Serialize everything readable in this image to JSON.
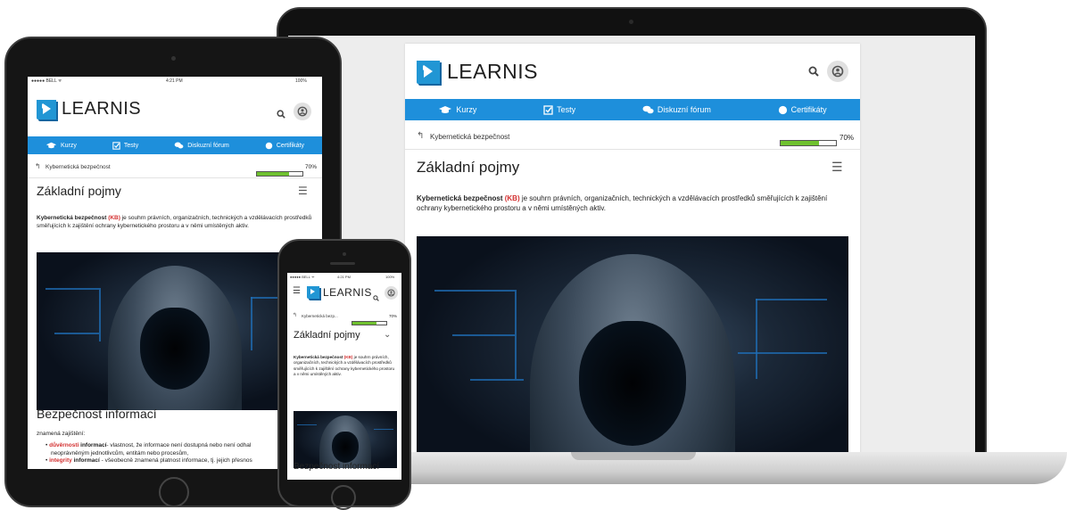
{
  "brand": {
    "name": "LEARNIS"
  },
  "nav": {
    "courses": "Kurzy",
    "tests": "Testy",
    "forum": "Diskuzní fórum",
    "certificates": "Certifikáty"
  },
  "breadcrumb": {
    "label": "Kybernetická bezpečnost",
    "short_label": "Kybernetická bezp...",
    "progress_text": "70%",
    "progress_value": 0.7
  },
  "lesson": {
    "title": "Základní pojmy",
    "intro_bold": "Kybernetická bezpečnost",
    "intro_abbr": "(KB)",
    "intro_rest": "je souhrn právních, organizačních, technických a vzdělávacích prostředků směřujících k zajištění ochrany kybernetického prostoru a v němi umístěných aktiv.",
    "section_title": "Bezpečnost informací",
    "section_intro": "znamená zajištění:",
    "bullets": [
      {
        "term": "důvěrnosti",
        "bold": "informací",
        "rest": "- vlastnost, že informace není dostupná nebo není odhal"
      },
      {
        "cont": "neoprávněným jednotlivcům, entitám nebo procesům,"
      },
      {
        "term": "integrity",
        "bold": "informací",
        "rest": "- všeobecně znamená platnost informace, tj. jejich přesnos"
      }
    ]
  },
  "tablet_status": {
    "carrier": "●●●●● BELL ᯤ",
    "time": "4:21 PM",
    "battery": "100%"
  },
  "phone_status": {
    "carrier": "●●●●● BELL ᯤ",
    "time": "4:21 PM",
    "battery": "100%"
  },
  "colors": {
    "accent": "#1e8fdb",
    "highlight": "#d32f2f",
    "progress": "#6fc12f"
  },
  "icons": [
    "search-icon",
    "user-icon",
    "graduation-cap-icon",
    "checkbox-icon",
    "chat-icon",
    "badge-icon",
    "back-arrow-icon",
    "menu-icon",
    "chevron-down-icon"
  ]
}
